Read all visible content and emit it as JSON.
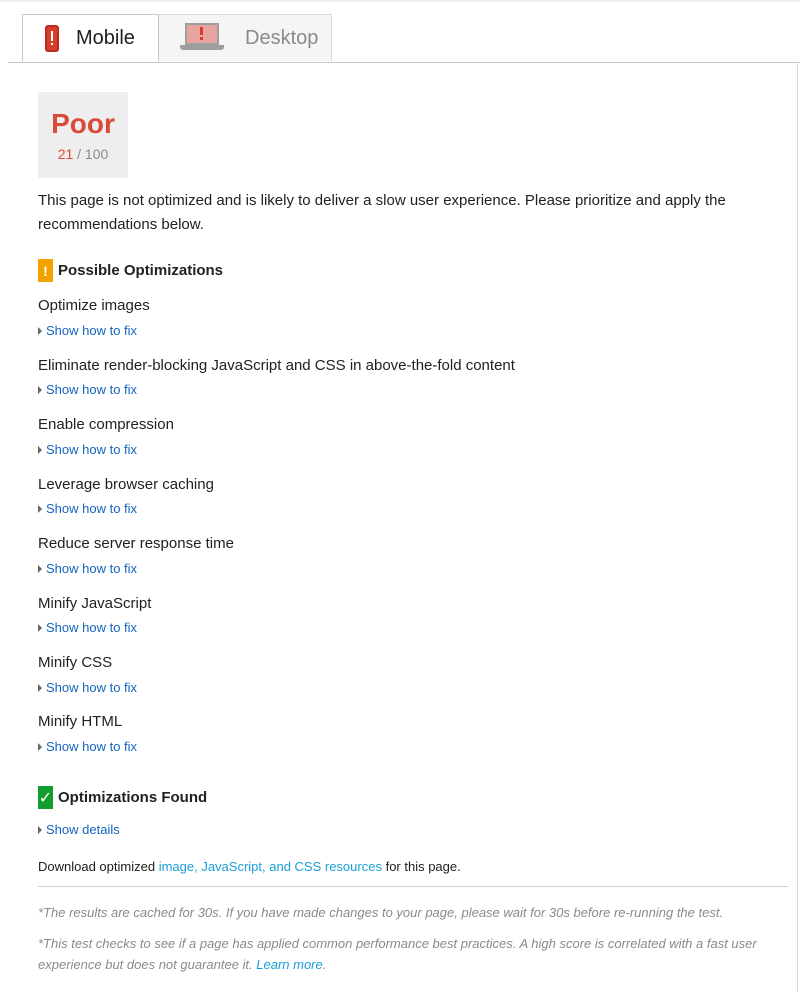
{
  "tabs": {
    "mobile": {
      "label": "Mobile"
    },
    "desktop": {
      "label": "Desktop"
    }
  },
  "score": {
    "label": "Poor",
    "value": "21",
    "max": "/ 100"
  },
  "summary": "This page is not optimized and is likely to deliver a slow user experience. Please prioritize and apply the recommendations below.",
  "possible": {
    "heading": "Possible Optimizations",
    "badge": "!",
    "link_label": "Show how to fix",
    "items": [
      "Optimize images",
      "Eliminate render-blocking JavaScript and CSS in above-the-fold content",
      "Enable compression",
      "Leverage browser caching",
      "Reduce server response time",
      "Minify JavaScript",
      "Minify CSS",
      "Minify HTML"
    ]
  },
  "found": {
    "heading": "Optimizations Found",
    "badge": "✓",
    "link_label": "Show details"
  },
  "download": {
    "prefix": "Download optimized ",
    "link": "image, JavaScript, and CSS resources",
    "suffix": " for this page."
  },
  "notes": {
    "cache": "*The results are cached for 30s. If you have made changes to your page, please wait for 30s before re-running the test.",
    "test": "*This test checks to see if a page has applied common performance best practices. A high score is correlated with a fast user experience but does not guarantee it. ",
    "learn_more": "Learn more",
    "period": "."
  },
  "colors": {
    "poor": "#d94a38",
    "warn": "#f2a300",
    "ok": "#139d2e",
    "link": "#1565c0"
  }
}
